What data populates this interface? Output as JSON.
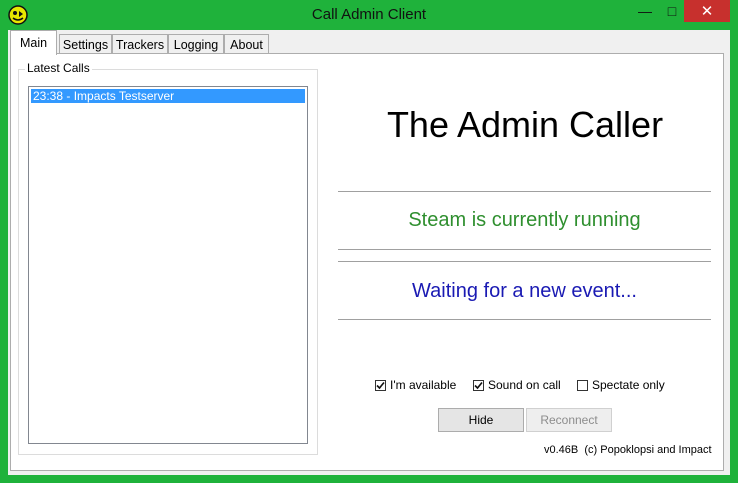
{
  "window": {
    "title": "Call Admin Client",
    "controls": {
      "minimize": "—",
      "maximize": "□",
      "close": "✕"
    },
    "accent_color": "#1fb23b"
  },
  "tabs": [
    {
      "label": "Main",
      "active": true
    },
    {
      "label": "Settings",
      "active": false
    },
    {
      "label": "Trackers",
      "active": false
    },
    {
      "label": "Logging",
      "active": false
    },
    {
      "label": "About",
      "active": false
    }
  ],
  "latest_calls": {
    "label": "Latest Calls",
    "items": [
      "23:38 - Impacts Testserver"
    ]
  },
  "main": {
    "heading": "The Admin Caller",
    "steam_status": "Steam is currently running",
    "event_status": "Waiting for a new event...",
    "steam_status_color": "#2f8f2f",
    "event_status_color": "#1a1ab3"
  },
  "options": {
    "available": {
      "label": "I'm available",
      "checked": true
    },
    "sound_on_call": {
      "label": "Sound on call",
      "checked": true
    },
    "spectate_only": {
      "label": "Spectate only",
      "checked": false
    }
  },
  "buttons": {
    "hide": "Hide",
    "reconnect": "Reconnect"
  },
  "footer": {
    "version": "v0.46B  (c) Popoklopsi and Impact"
  }
}
